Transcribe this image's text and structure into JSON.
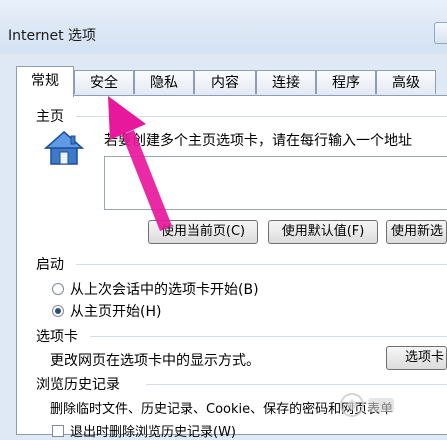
{
  "window": {
    "title": "Internet 选项"
  },
  "tabs": [
    {
      "label": "常规",
      "active": true
    },
    {
      "label": "安全",
      "active": false
    },
    {
      "label": "隐私",
      "active": false
    },
    {
      "label": "内容",
      "active": false
    },
    {
      "label": "连接",
      "active": false
    },
    {
      "label": "程序",
      "active": false
    },
    {
      "label": "高级",
      "active": false
    }
  ],
  "home": {
    "section_title": "主页",
    "description": "若要创建多个主页选项卡，请在每行输入一个地址",
    "url_value": "",
    "buttons": {
      "use_current": "使用当前页(C)",
      "use_default": "使用默认值(F)",
      "use_new_tab": "使用新选"
    }
  },
  "startup": {
    "section_title": "启动",
    "options": [
      {
        "label": "从上次会话中的选项卡开始(B)",
        "checked": false
      },
      {
        "label": "从主页开始(H)",
        "checked": true
      }
    ]
  },
  "tabs_section": {
    "section_title": "选项卡",
    "description": "更改网页在选项卡中的显示方式。",
    "button": "选项卡"
  },
  "history": {
    "section_title": "浏览历史记录",
    "description": "删除临时文件、历史记录、Cookie、保存的密码和网页表单",
    "checkbox_label": "退出时删除浏览历史记录(W)"
  },
  "colors": {
    "accent_arrow": "#e8189c",
    "panel_border": "#8d9eb4"
  },
  "icons": {
    "home": "house-icon",
    "annotation": "pink-arrow"
  }
}
